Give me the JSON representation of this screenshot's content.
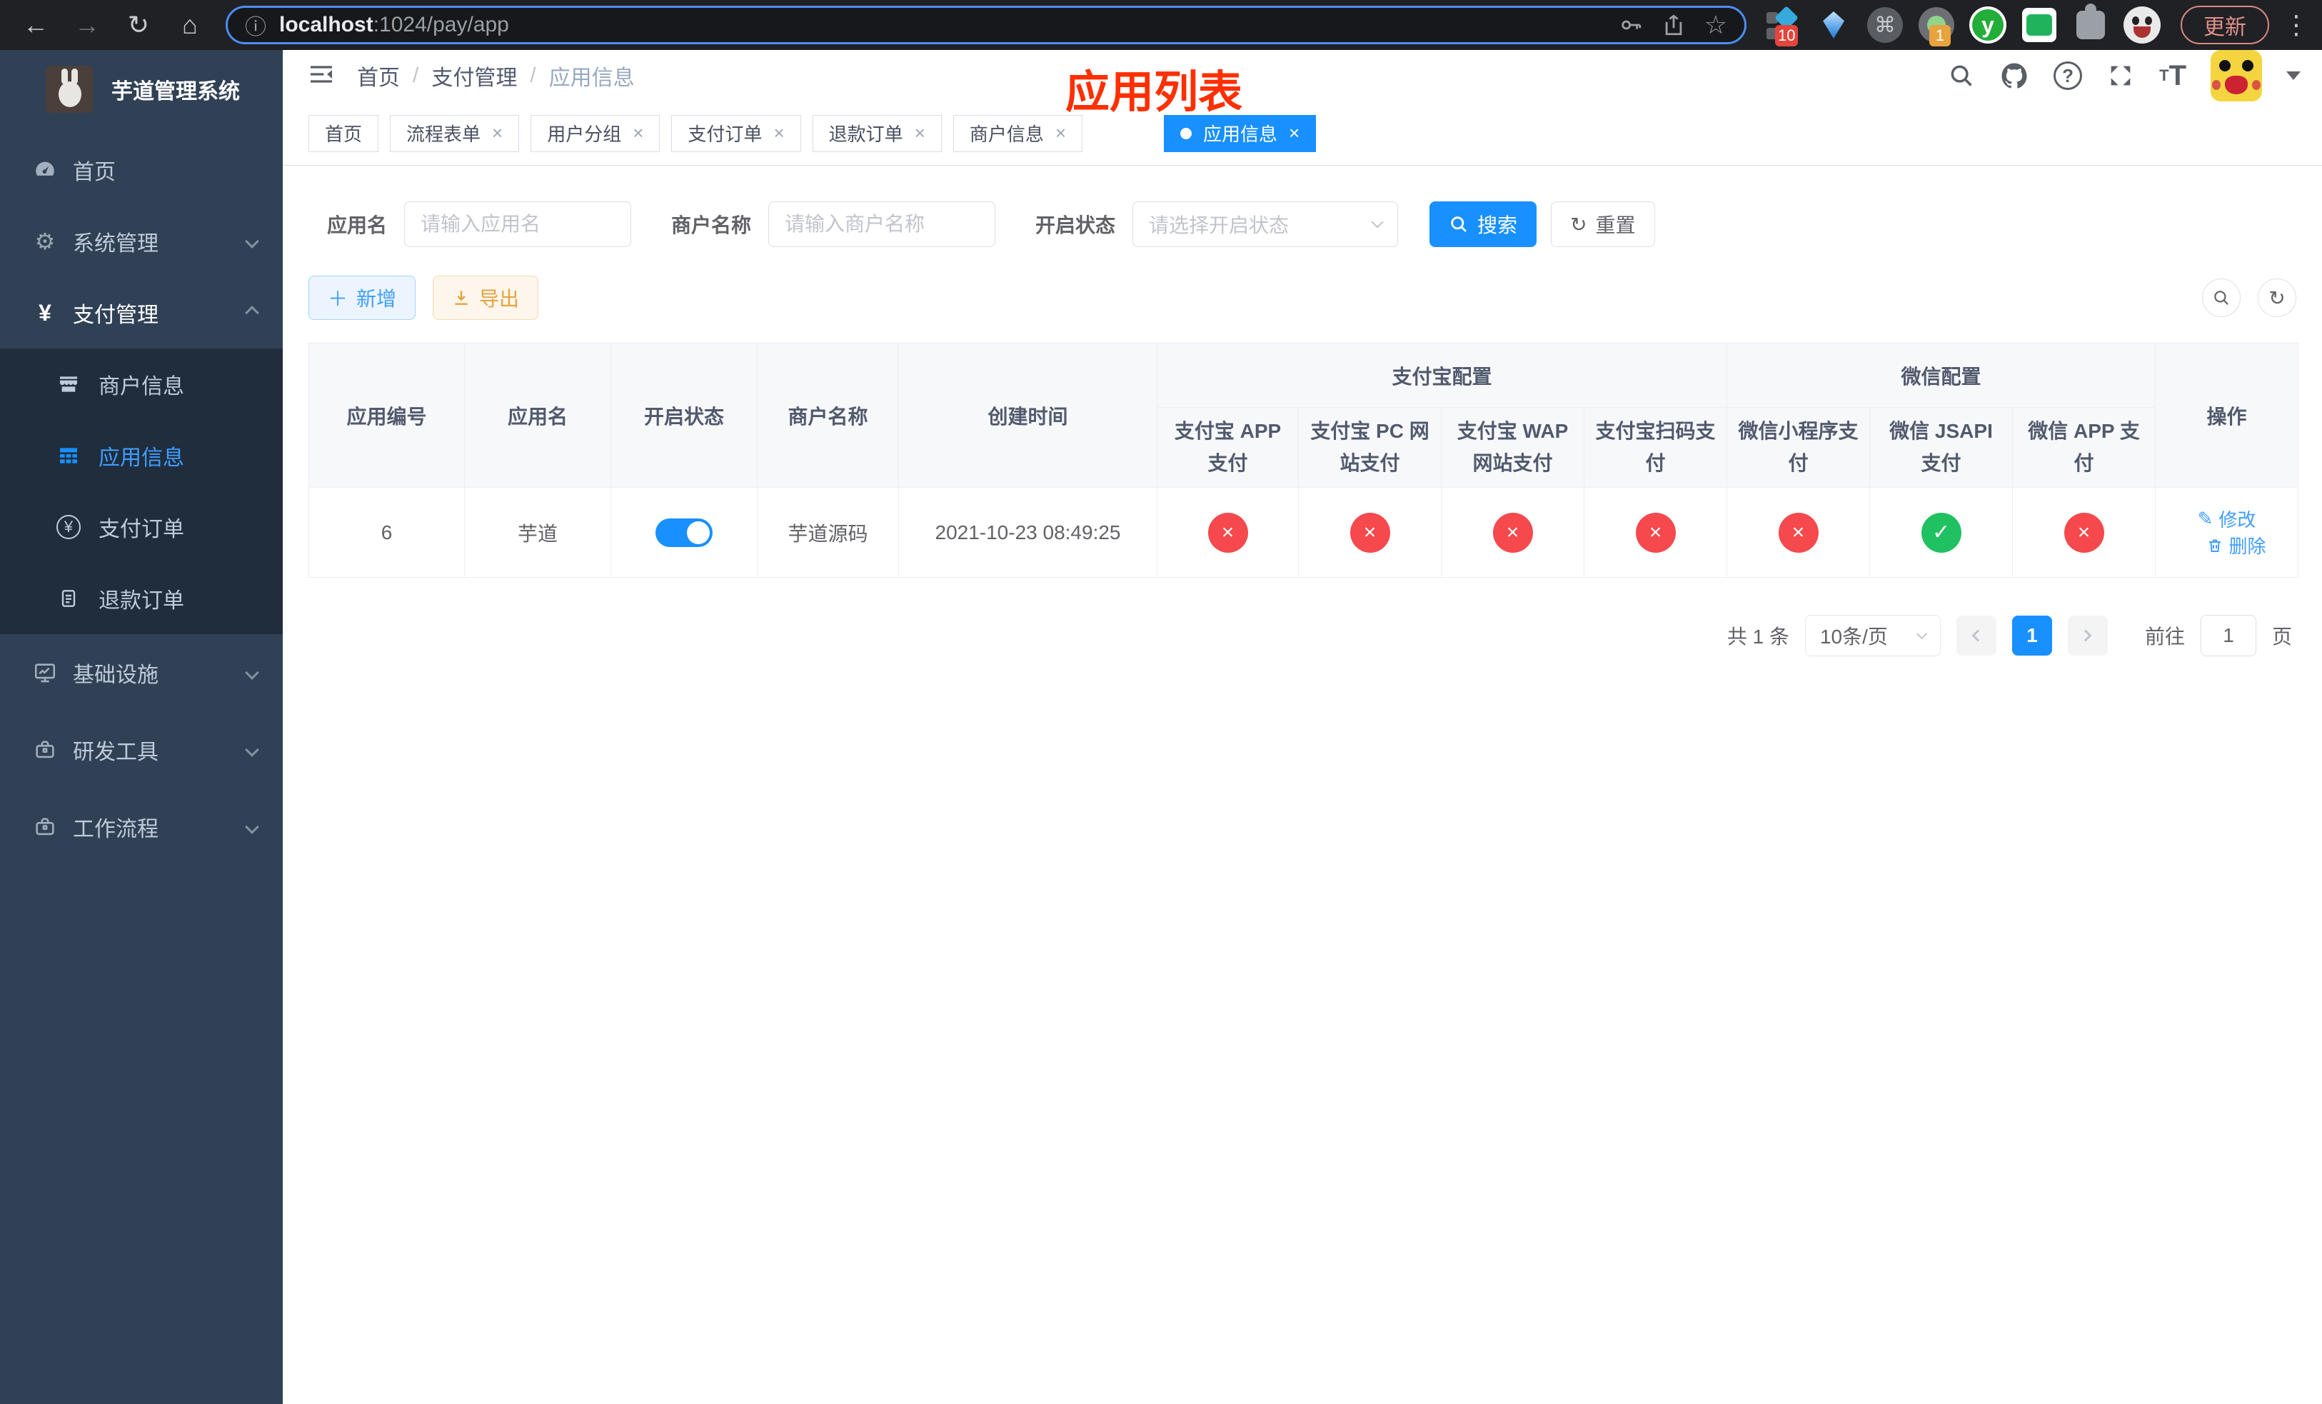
{
  "browser": {
    "url": {
      "host": "localhost",
      "path": ":1024/pay/app"
    },
    "update_label": "更新",
    "extensions": {
      "badge_a": "10",
      "badge_b": "1",
      "letter_y": "y"
    }
  },
  "sidebar": {
    "title": "芋道管理系统",
    "items": {
      "home": "首页",
      "system": "系统管理",
      "payment": "支付管理",
      "merchant_info": "商户信息",
      "app_info": "应用信息",
      "pay_order": "支付订单",
      "refund_order": "退款订单",
      "infra": "基础设施",
      "dev_tools": "研发工具",
      "workflow": "工作流程"
    }
  },
  "navbar": {
    "breadcrumb": {
      "home": "首页",
      "section": "支付管理",
      "current": "应用信息"
    }
  },
  "overlay_title": "应用列表",
  "tabs": [
    {
      "label": "首页",
      "closable": false,
      "active": false
    },
    {
      "label": "流程表单",
      "closable": true,
      "active": false
    },
    {
      "label": "用户分组",
      "closable": true,
      "active": false
    },
    {
      "label": "支付订单",
      "closable": true,
      "active": false
    },
    {
      "label": "退款订单",
      "closable": true,
      "active": false
    },
    {
      "label": "商户信息",
      "closable": true,
      "active": false
    },
    {
      "label": "应用信息",
      "closable": true,
      "active": true
    }
  ],
  "filters": {
    "app_name": {
      "label": "应用名",
      "placeholder": "请输入应用名",
      "value": ""
    },
    "merchant_name": {
      "label": "商户名称",
      "placeholder": "请输入商户名称",
      "value": ""
    },
    "status": {
      "label": "开启状态",
      "placeholder": "请选择开启状态"
    },
    "search_label": "搜索",
    "reset_label": "重置"
  },
  "toolbar": {
    "add_label": "新增",
    "export_label": "导出"
  },
  "table": {
    "columns": {
      "id": "应用编号",
      "name": "应用名",
      "status": "开启状态",
      "merchant": "商户名称",
      "created": "创建时间",
      "alipay_group": "支付宝配置",
      "wechat_group": "微信配置",
      "alipay_app": "支付宝 APP 支付",
      "alipay_pc": "支付宝 PC 网站支付",
      "alipay_wap": "支付宝 WAP 网站支付",
      "alipay_qr": "支付宝扫码支付",
      "wx_mini": "微信小程序支付",
      "wx_jsapi": "微信 JSAPI 支付",
      "wx_app": "微信 APP 支付",
      "ops": "操作"
    },
    "row": {
      "id": "6",
      "name": "芋道",
      "status_on": true,
      "merchant": "芋道源码",
      "created": "2021-10-23 08:49:25",
      "channels": {
        "alipay_app": false,
        "alipay_pc": false,
        "alipay_wap": false,
        "alipay_qr": false,
        "wx_mini": false,
        "wx_jsapi": true,
        "wx_app": false
      },
      "edit_label": "修改",
      "delete_label": "删除"
    }
  },
  "pagination": {
    "total": "共 1 条",
    "page_size": "10条/页",
    "current_page": "1",
    "goto_label": "前往",
    "unit_label": "页",
    "goto_value": "1"
  },
  "colors": {
    "primary": "#1890ff",
    "link": "#409eff",
    "danger": "#f5494d",
    "success": "#20c161",
    "warning": "#e6a23c",
    "sidebar_bg": "#304156",
    "submenu_bg": "#1f2d3d",
    "overlay_red": "#ff2f00"
  }
}
